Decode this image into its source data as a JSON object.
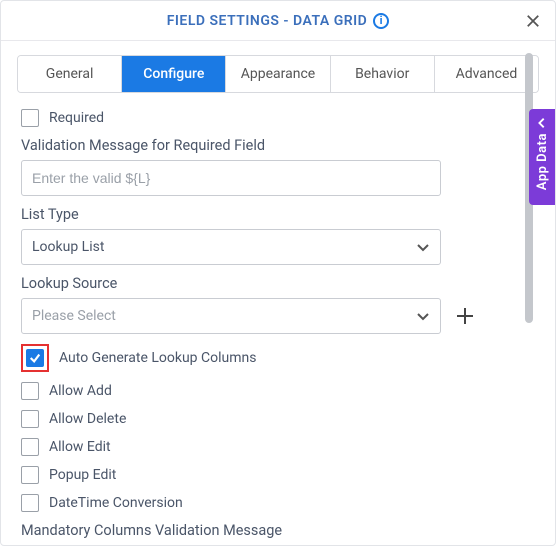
{
  "header": {
    "title": "FIELD SETTINGS - DATA GRID"
  },
  "tabs": [
    {
      "label": "General",
      "active": false
    },
    {
      "label": "Configure",
      "active": true
    },
    {
      "label": "Appearance",
      "active": false
    },
    {
      "label": "Behavior",
      "active": false
    },
    {
      "label": "Advanced",
      "active": false
    }
  ],
  "sideTab": {
    "label": "App Data"
  },
  "form": {
    "required": {
      "label": "Required",
      "checked": false
    },
    "validationMessage": {
      "label": "Validation Message for Required Field",
      "placeholder": "Enter the valid ${L}",
      "value": ""
    },
    "listType": {
      "label": "List Type",
      "value": "Lookup List"
    },
    "lookupSource": {
      "label": "Lookup Source",
      "placeholder": "Please Select",
      "value": ""
    },
    "checks": [
      {
        "label": "Auto Generate Lookup Columns",
        "checked": true,
        "highlighted": true
      },
      {
        "label": "Allow Add",
        "checked": false
      },
      {
        "label": "Allow Delete",
        "checked": false
      },
      {
        "label": "Allow Edit",
        "checked": false
      },
      {
        "label": "Popup Edit",
        "checked": false
      },
      {
        "label": "DateTime Conversion",
        "checked": false
      }
    ],
    "mandatoryColumns": {
      "label": "Mandatory Columns Validation Message"
    }
  }
}
